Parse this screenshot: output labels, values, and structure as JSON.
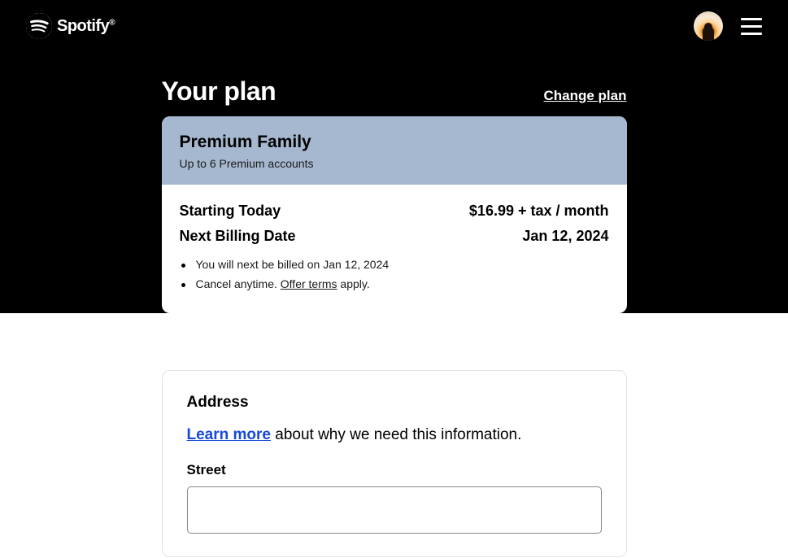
{
  "header": {
    "brand": "Spotify",
    "trademark": "®"
  },
  "plan": {
    "heading": "Your plan",
    "change_label": "Change plan",
    "name": "Premium Family",
    "subtitle": "Up to 6 Premium accounts",
    "rows": [
      {
        "label": "Starting Today",
        "value": "$16.99 + tax / month"
      },
      {
        "label": "Next Billing Date",
        "value": "Jan 12, 2024"
      }
    ],
    "bullets": {
      "bill_note": "You will next be billed on Jan 12, 2024",
      "cancel_pre": "Cancel anytime. ",
      "offer_terms": "Offer terms",
      "cancel_post": " apply."
    }
  },
  "address": {
    "title": "Address",
    "learn_more": "Learn more",
    "desc_rest": " about why we need this information.",
    "street_label": "Street",
    "street_value": ""
  }
}
